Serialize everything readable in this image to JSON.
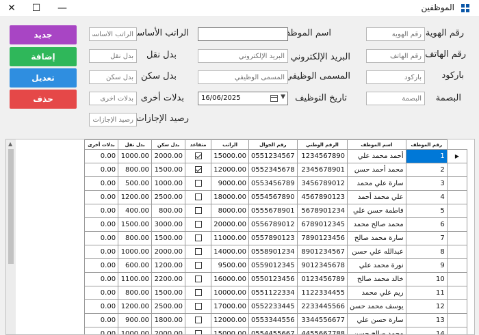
{
  "window": {
    "title": "الموظفين"
  },
  "labels": {
    "national_id": "رقم الهوية",
    "name": "اسم الموظف",
    "basic_salary": "الراتب الأساسي",
    "phone": "رقم الهاتف",
    "email": "البريد الإلكتروني",
    "transport": "بدل نقل",
    "barcode": "باركود",
    "job_title": "المسمى الوظيفي",
    "housing": "بدل سكن",
    "fingerprint": "البصمة",
    "hire_date": "تاريخ التوظيف",
    "other_allowances": "بدلات أخرى",
    "leave_balance": "رصيد الإجازات"
  },
  "placeholders": {
    "national_id": "رقم الهوية",
    "name": "",
    "basic_salary": "الراتب الأساسي",
    "phone": "رقم الهاتف",
    "email": "البريد الإلكتروني",
    "transport": "بدل نقل",
    "barcode": "باركود",
    "job_title": "المسمى الوظيفي",
    "housing": "بدل سكن",
    "fingerprint": "البصمة",
    "other_allowances": "بدلات أخرى",
    "leave_balance": "رصيد الإجازات"
  },
  "hire_date_value": "16/06/2025",
  "buttons": {
    "new": "جديد",
    "add": "إضافة",
    "edit": "تعديل",
    "delete": "حذف"
  },
  "colors": {
    "new": "#a845c4",
    "add": "#2fb75a",
    "edit": "#2f8ee0",
    "delete": "#e54848",
    "selection": "#0078d7"
  },
  "icons": {
    "app": "windows-form-icon",
    "calendar": "calendar-icon",
    "row_pointer": "triangle-right-icon"
  },
  "table": {
    "headers": {
      "index": "رقم الموظف",
      "name": "اسم الموظف",
      "national_id": "الرقم الوطني",
      "phone": "رقم الجوال",
      "salary": "الراتب",
      "retired": "متقاعد",
      "housing": "بدل سكن",
      "transport": "بدل نقل",
      "other": "بدلات أخرى"
    },
    "rows": [
      {
        "index": "1",
        "name": "أحمد محمد علي",
        "national_id": "1234567890",
        "phone": "0551234567",
        "salary": "15000.00",
        "retired": true,
        "housing": "2000.00",
        "transport": "1000.00",
        "other": "0.00"
      },
      {
        "index": "2",
        "name": "محمد أحمد حسن",
        "national_id": "2345678901",
        "phone": "0552345678",
        "salary": "12000.00",
        "retired": true,
        "housing": "1500.00",
        "transport": "800.00",
        "other": "0.00"
      },
      {
        "index": "3",
        "name": "سارة علي محمد",
        "national_id": "3456789012",
        "phone": "0553456789",
        "salary": "9000.00",
        "retired": false,
        "housing": "1000.00",
        "transport": "500.00",
        "other": "0.00"
      },
      {
        "index": "4",
        "name": "علي محمد أحمد",
        "national_id": "4567890123",
        "phone": "0554567890",
        "salary": "18000.00",
        "retired": false,
        "housing": "2500.00",
        "transport": "1200.00",
        "other": "0.00"
      },
      {
        "index": "5",
        "name": "فاطمة حسن علي",
        "national_id": "5678901234",
        "phone": "0555678901",
        "salary": "8000.00",
        "retired": false,
        "housing": "800.00",
        "transport": "400.00",
        "other": "0.00"
      },
      {
        "index": "6",
        "name": "محمد صالح محمد",
        "national_id": "6789012345",
        "phone": "0556789012",
        "salary": "20000.00",
        "retired": false,
        "housing": "3000.00",
        "transport": "1500.00",
        "other": "0.00"
      },
      {
        "index": "7",
        "name": "سارة محمد صالح",
        "national_id": "7890123456",
        "phone": "0557890123",
        "salary": "11000.00",
        "retired": false,
        "housing": "1500.00",
        "transport": "800.00",
        "other": "0.00"
      },
      {
        "index": "8",
        "name": "عبدالله علي حسن",
        "national_id": "8901234567",
        "phone": "0558901234",
        "salary": "14000.00",
        "retired": false,
        "housing": "2000.00",
        "transport": "1000.00",
        "other": "0.00"
      },
      {
        "index": "9",
        "name": "نورة محمد علي",
        "national_id": "9012345678",
        "phone": "0559012345",
        "salary": "9500.00",
        "retired": false,
        "housing": "1200.00",
        "transport": "600.00",
        "other": "0.00"
      },
      {
        "index": "10",
        "name": "خالد محمد صالح",
        "national_id": "0123456789",
        "phone": "0550123456",
        "salary": "16000.00",
        "retired": false,
        "housing": "2200.00",
        "transport": "1100.00",
        "other": "0.00"
      },
      {
        "index": "11",
        "name": "ريم علي محمد",
        "national_id": "1122334455",
        "phone": "0551122334",
        "salary": "10000.00",
        "retired": false,
        "housing": "1500.00",
        "transport": "800.00",
        "other": "0.00"
      },
      {
        "index": "12",
        "name": "يوسف محمد حسن",
        "national_id": "2233445566",
        "phone": "0552233445",
        "salary": "17000.00",
        "retired": false,
        "housing": "2500.00",
        "transport": "1200.00",
        "other": "0.00"
      },
      {
        "index": "13",
        "name": "سارة حسن علي",
        "national_id": "3344556677",
        "phone": "0553344556",
        "salary": "12000.00",
        "retired": false,
        "housing": "1800.00",
        "transport": "900.00",
        "other": "0.00"
      },
      {
        "index": "14",
        "name": "محمد صالح حسن",
        "national_id": "4455667788",
        "phone": "0554455667",
        "salary": "15000.00",
        "retired": false,
        "housing": "2000.00",
        "transport": "1000.00",
        "other": "0.00"
      }
    ]
  }
}
